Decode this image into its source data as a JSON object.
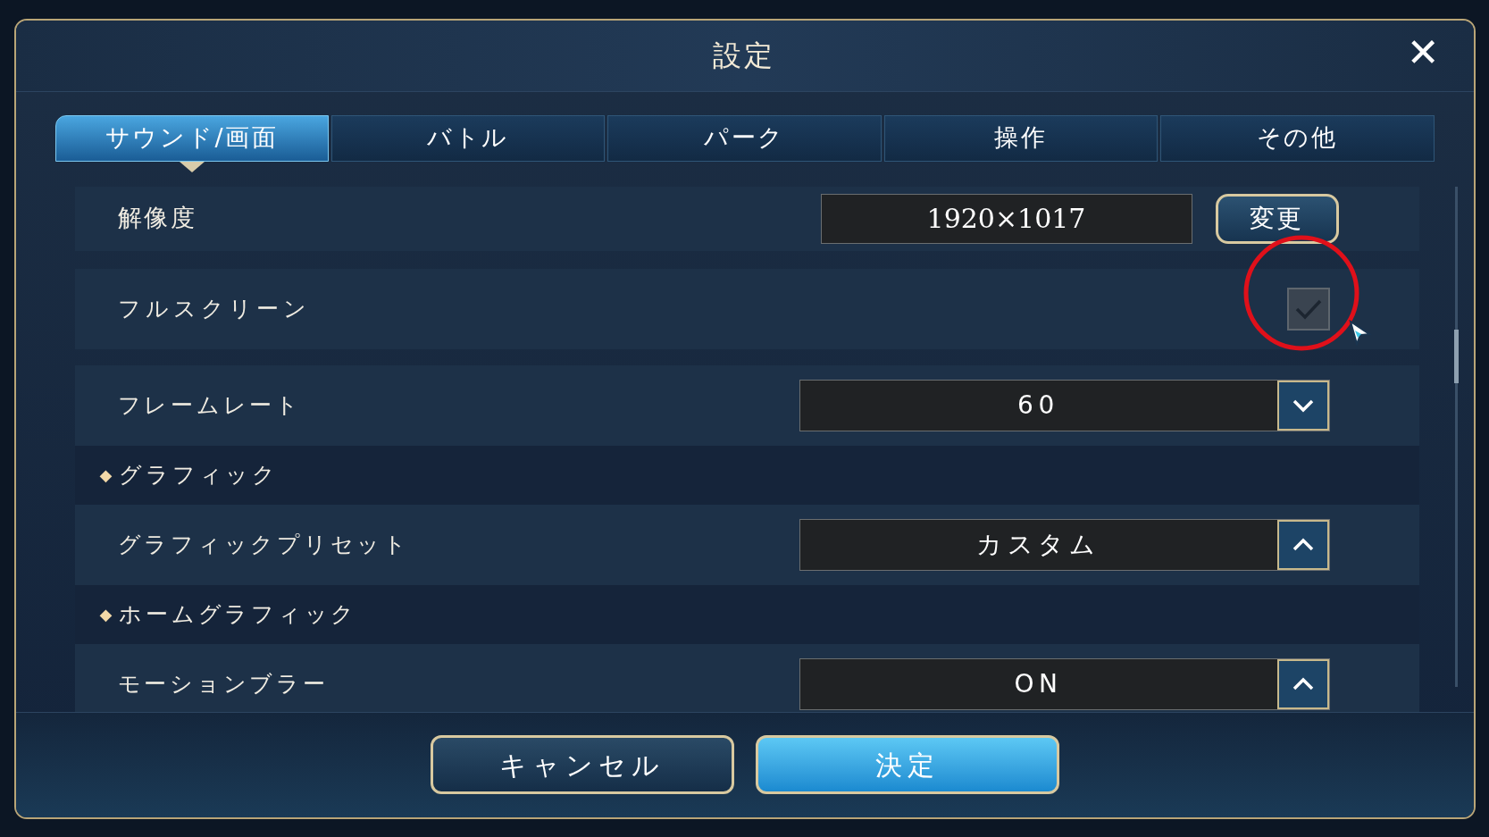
{
  "window": {
    "title": "設定",
    "close": "✕"
  },
  "tabs": [
    {
      "label": "サウンド/画面",
      "selected": true
    },
    {
      "label": "バトル",
      "selected": false
    },
    {
      "label": "パーク",
      "selected": false
    },
    {
      "label": "操作",
      "selected": false
    },
    {
      "label": "その他",
      "selected": false
    }
  ],
  "rows": [
    {
      "kind": "resolution",
      "label": "解像度",
      "value": "1920×1017",
      "button": "変更"
    },
    {
      "kind": "checkbox",
      "label": "フルスクリーン",
      "checked": true,
      "disabled": true
    },
    {
      "kind": "dropdown",
      "label": "フレームレート",
      "value": "60",
      "expanded": false
    },
    {
      "kind": "header",
      "bullet": "◆",
      "label": "グラフィック"
    },
    {
      "kind": "dropdown",
      "label": "グラフィックプリセット",
      "value": "カスタム",
      "expanded": true
    },
    {
      "kind": "header",
      "bullet": "◆",
      "label": "ホームグラフィック"
    },
    {
      "kind": "dropdown",
      "label": "モーションブラー",
      "value": "ON",
      "expanded": true
    }
  ],
  "buttons": [
    {
      "label": "キャンセル",
      "primary": false
    },
    {
      "label": "決定",
      "primary": true
    }
  ]
}
